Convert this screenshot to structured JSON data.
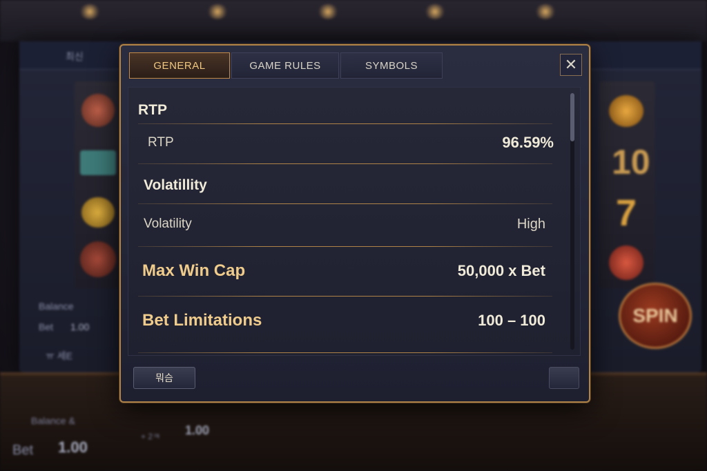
{
  "background": {
    "left_panel": {
      "header_text": "최신",
      "balance_label": "Balance",
      "bet_label": "Bet",
      "bet_value": "1.00",
      "footer_text": "ㅠ  세E"
    },
    "right_panel": {
      "reel_number": "10",
      "reel_seven": "7",
      "spin_label": "SPIN"
    },
    "counter": {
      "balance_label": "Balance &",
      "bet_label": "Bet",
      "bet_value": "1.00",
      "mid_value": "1.00",
      "plus_text": "+ 2ㅋ"
    }
  },
  "modal": {
    "tabs": [
      {
        "label": "GENERAL",
        "active": true
      },
      {
        "label": "GAME RULES",
        "active": false
      },
      {
        "label": "SYMBOLS",
        "active": false
      }
    ],
    "close_icon": "close-icon",
    "sections": {
      "rtp_title": "RTP",
      "rtp_label": "RTP",
      "rtp_value": "96.59%",
      "volatility_title": "Volatillity",
      "volatility_label": "Volatility",
      "volatility_value": "High",
      "max_win_label": "Max Win Cap",
      "max_win_value": "50,000 x Bet",
      "bet_limits_label": "Bet Limitations",
      "bet_limits_value": "100 – 100"
    },
    "footer_button": "뭐슴"
  },
  "colors": {
    "accent_gold": "#b08448",
    "label_gold": "#f0cc8c",
    "panel_dark": "#1f2130"
  }
}
